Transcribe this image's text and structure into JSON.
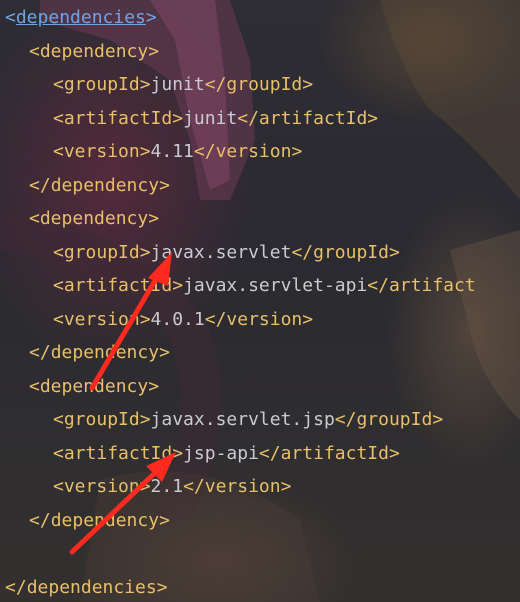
{
  "lines": [
    {
      "open": "<",
      "tag": "dependencies",
      "close": ">",
      "indent": 0,
      "highlight": true
    },
    {
      "open": "<",
      "tag": "dependency",
      "close": ">",
      "indent": 1
    },
    {
      "open": "<",
      "tag": "groupId",
      "close": ">",
      "value": "junit",
      "end": "</groupId>",
      "indent": 2
    },
    {
      "open": "<",
      "tag": "artifactId",
      "close": ">",
      "value": "junit",
      "end": "</artifactId>",
      "indent": 2
    },
    {
      "open": "<",
      "tag": "version",
      "close": ">",
      "value": "4.11",
      "end": "</version>",
      "indent": 2
    },
    {
      "open": "</",
      "tag": "dependency",
      "close": ">",
      "indent": 1
    },
    {
      "open": "<",
      "tag": "dependency",
      "close": ">",
      "indent": 1
    },
    {
      "open": "<",
      "tag": "groupId",
      "close": ">",
      "value": "javax.servlet",
      "end": "</groupId>",
      "indent": 2
    },
    {
      "open": "<",
      "tag": "artifactId",
      "close": ">",
      "value": "javax.servlet-api",
      "end": "</artifact",
      "indent": 2
    },
    {
      "open": "<",
      "tag": "version",
      "close": ">",
      "value": "4.0.1",
      "end": "</version>",
      "indent": 2
    },
    {
      "open": "</",
      "tag": "dependency",
      "close": ">",
      "indent": 1
    },
    {
      "open": "<",
      "tag": "dependency",
      "close": ">",
      "indent": 1
    },
    {
      "open": "<",
      "tag": "groupId",
      "close": ">",
      "value": "javax.servlet.jsp",
      "end": "</groupId>",
      "indent": 2
    },
    {
      "open": "<",
      "tag": "artifactId",
      "close": ">",
      "value": "jsp-api",
      "end": "</artifactId>",
      "indent": 2
    },
    {
      "open": "<",
      "tag": "version",
      "close": ">",
      "value": "2.1",
      "end": "</version>",
      "indent": 2
    },
    {
      "open": "</",
      "tag": "dependency",
      "close": ">",
      "indent": 1
    },
    {
      "blank": true
    },
    {
      "open": "</",
      "tag": "dependencies",
      "close": ">",
      "indent": 0
    }
  ],
  "colors": {
    "tag": "#e8bf6a",
    "text": "#c9cbd0",
    "highlight": "#6fa3e6",
    "arrow": "#ff2a1f"
  },
  "annotations": [
    "red-arrow-1",
    "red-arrow-2"
  ]
}
